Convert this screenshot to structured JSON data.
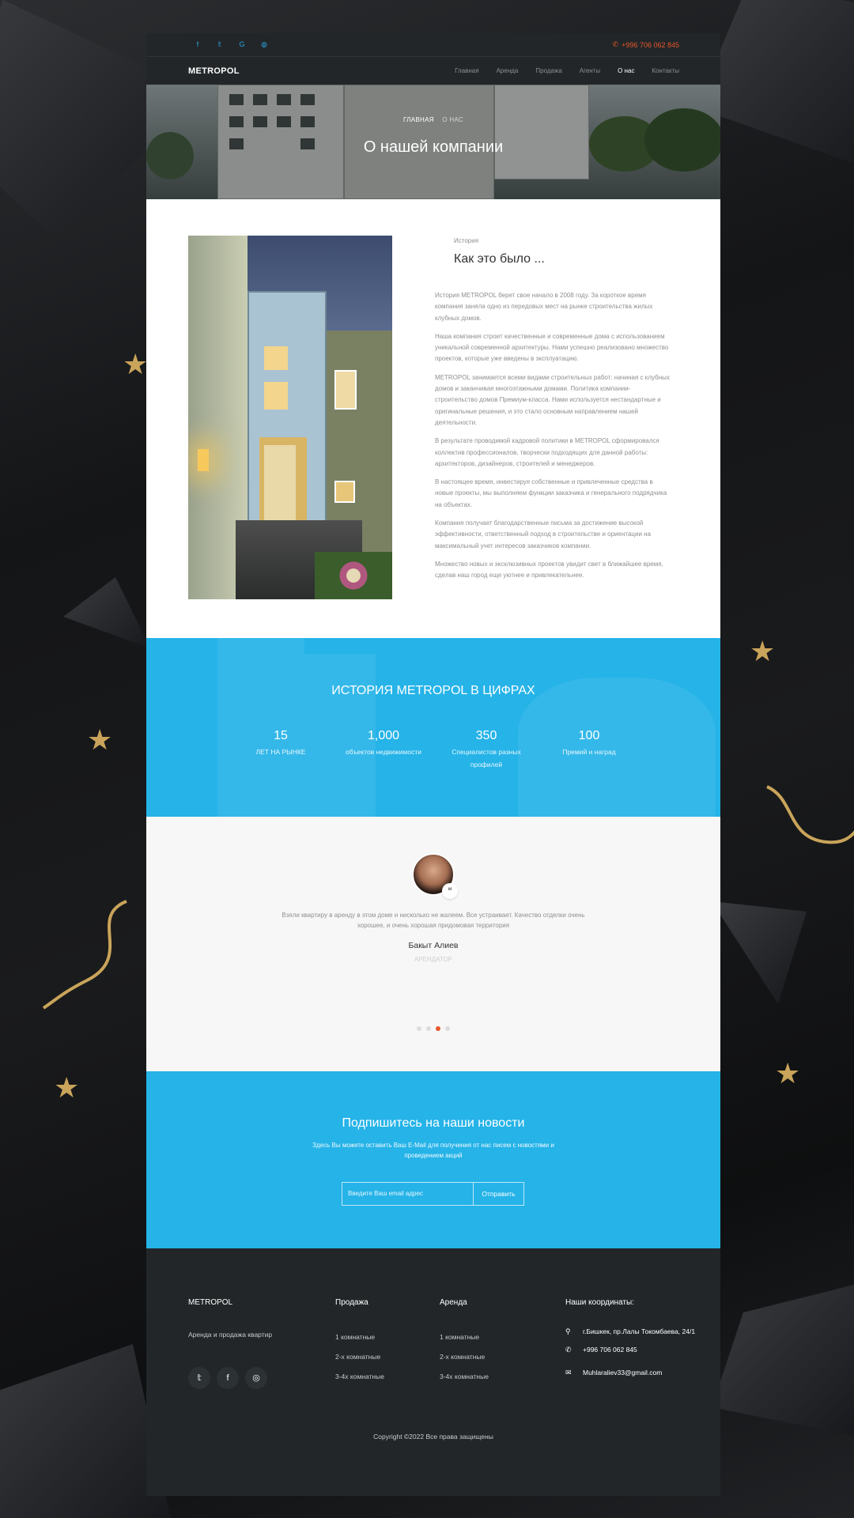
{
  "topbar": {
    "social_icons": [
      "facebook-icon",
      "twitter-icon",
      "google-icon",
      "dribbble-icon"
    ],
    "social_glyphs": [
      "f",
      "𝕥",
      "G",
      "◍"
    ],
    "phone": "+996 706 062 845"
  },
  "navbar": {
    "logo": "METROPOL",
    "menu": [
      "Главная",
      "Аренда",
      "Продажа",
      "Агенты",
      "О нас",
      "Контакты"
    ],
    "active": "О нас"
  },
  "hero": {
    "breadcrumb_home": "ГЛАВНАЯ",
    "breadcrumb_current": "О НАС",
    "title": "О нашей компании"
  },
  "about": {
    "eyebrow": "История",
    "heading": "Как это было ...",
    "paragraphs": [
      "История METROPOL берет свое начало в 2008 году. За короткое время компания заняла одно из передовых мест на рынке строительства жилых клубных домов.",
      "Наша компания строит качественные и современные дома с использованием уникальной современной архитектуры. Нами успешно реализовано множество проектов, которые уже введены в эксплуатацию.",
      "METROPOL занимается всеми видами строительных работ: начиная с клубных домов и заканчивая многоэтажными домами. Политика компании-строительство домов Премиум-класса. Нами используется нестандартные и оригинальные решения, и это стало основным направлением нашей деятельности.",
      "В результате проводимой кадровой политики в METROPOL сформировался коллектив профессионалов, творчески подходящих для данной работы: архитекторов, дизайнеров, строителей и менеджеров.",
      "В настоящее время, инвестируя собственные и привлеченные средства в новые проекты, мы выполняем функции заказчика и генерального подрядчика на объектах.",
      "Компания получает благодарственные письма за достижение высокой эффективности, ответственный подход в строительстве и ориентации на максимальный учет интересов заказчиков компании.",
      "Множество новых и эксклюзивных проектов увидит свет в ближайшее время, сделав наш город еще уютнее и привлекательнее."
    ]
  },
  "stats": {
    "heading": "ИСТОРИЯ METROPOL В ЦИФРАХ",
    "items": [
      {
        "num": "15",
        "label": "ЛЕТ НА РЫНКЕ"
      },
      {
        "num": "1,000",
        "label": "объектов недвижимости"
      },
      {
        "num": "350",
        "label": "Специалистов разных профилей"
      },
      {
        "num": "100",
        "label": "Премий и наград"
      }
    ]
  },
  "testimonial": {
    "quote_glyph": "❝",
    "text": "Взяли квартиру в аренду в этом доме и нисколько не жалеем. Все устраивает. Качество отделки очень хорошее, и очень хорошая придомовая территория",
    "name": "Бакыт Алиев",
    "role": "АРЕНДАТОР",
    "dots": 4,
    "active_dot": 3
  },
  "newsletter": {
    "heading": "Подпишитесь на наши новости",
    "subtext": "Здесь Вы можете оставить Ваш E-Mail для получения от нас писем с новостями и проведением акций",
    "placeholder": "Введите Ваш email адрес",
    "button": "Отправить"
  },
  "footer": {
    "brand": "METROPOL",
    "tagline": "Аренда и продажа квартир",
    "social_icons": [
      "twitter-icon",
      "facebook-icon",
      "instagram-icon"
    ],
    "social_glyphs": [
      "𝕥",
      "f",
      "◎"
    ],
    "sale": {
      "title": "Продажа",
      "items": [
        "1 комнатные",
        "2-х комнатные",
        "3-4х комнатные"
      ]
    },
    "rent": {
      "title": "Аренда",
      "items": [
        "1 комнатные",
        "2-х комнатные",
        "3-4х комнатные"
      ]
    },
    "contacts": {
      "title": "Наши координаты:",
      "address": "г.Бишкек, пр.Лалы Токомбаева, 24/1",
      "phone": "+996 706 062 845",
      "email": "Muhlaraliev33@gmail.com"
    },
    "copyright": "Copyright ©2022 Все права защищены"
  },
  "colors": {
    "accent": "#25b3e8",
    "phone": "#e8572b",
    "dark": "#222628",
    "gold": "#c9a45a"
  }
}
